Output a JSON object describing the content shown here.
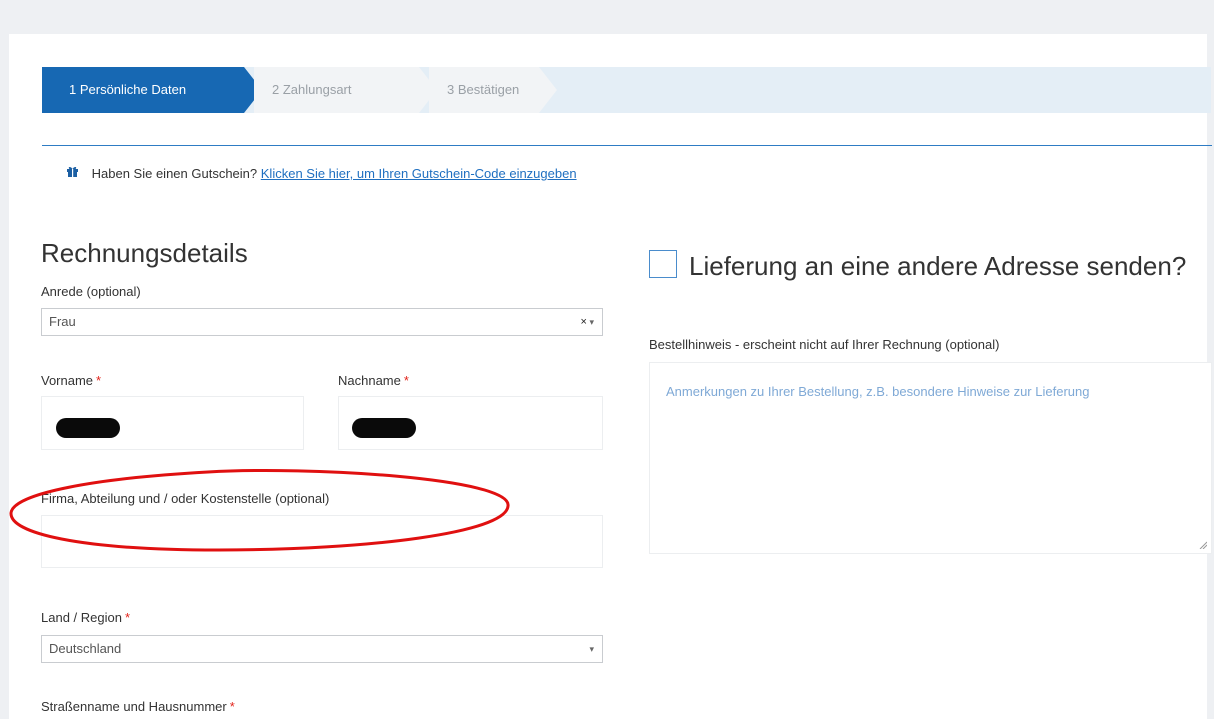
{
  "steps": [
    {
      "label": "1 Persönliche Daten",
      "active": true
    },
    {
      "label": "2 Zahlungsart",
      "active": false
    },
    {
      "label": "3 Bestätigen",
      "active": false
    }
  ],
  "coupon": {
    "icon": "gift-icon",
    "text": "Haben Sie einen Gutschein?",
    "link": "Klicken Sie hier, um Ihren Gutschein-Code einzugeben"
  },
  "billing": {
    "title": "Rechnungsdetails",
    "salutation": {
      "label": "Anrede (optional)",
      "value": "Frau",
      "clear": "×",
      "arrow": "▾"
    },
    "first_name": {
      "label": "Vorname",
      "required": "*"
    },
    "last_name": {
      "label": "Nachname",
      "required": "*"
    },
    "company": {
      "label": "Firma, Abteilung und / oder Kostenstelle (optional)"
    },
    "country": {
      "label": "Land / Region",
      "required": "*",
      "value": "Deutschland",
      "arrow": "▾"
    },
    "street": {
      "label": "Straßenname und Hausnummer",
      "required": "*"
    }
  },
  "shipping": {
    "checkbox_label": "Lieferung an eine andere Adresse senden?",
    "checked": false
  },
  "order_notes": {
    "label": "Bestellhinweis - erscheint nicht auf Ihrer Rechnung (optional)",
    "placeholder": "Anmerkungen zu Ihrer Bestellung, z.B. besondere Hinweise zur Lieferung"
  },
  "colors": {
    "primary": "#1768b3",
    "required": "#e2231a",
    "link": "#1f6fc0",
    "annotation": "#e01010"
  }
}
